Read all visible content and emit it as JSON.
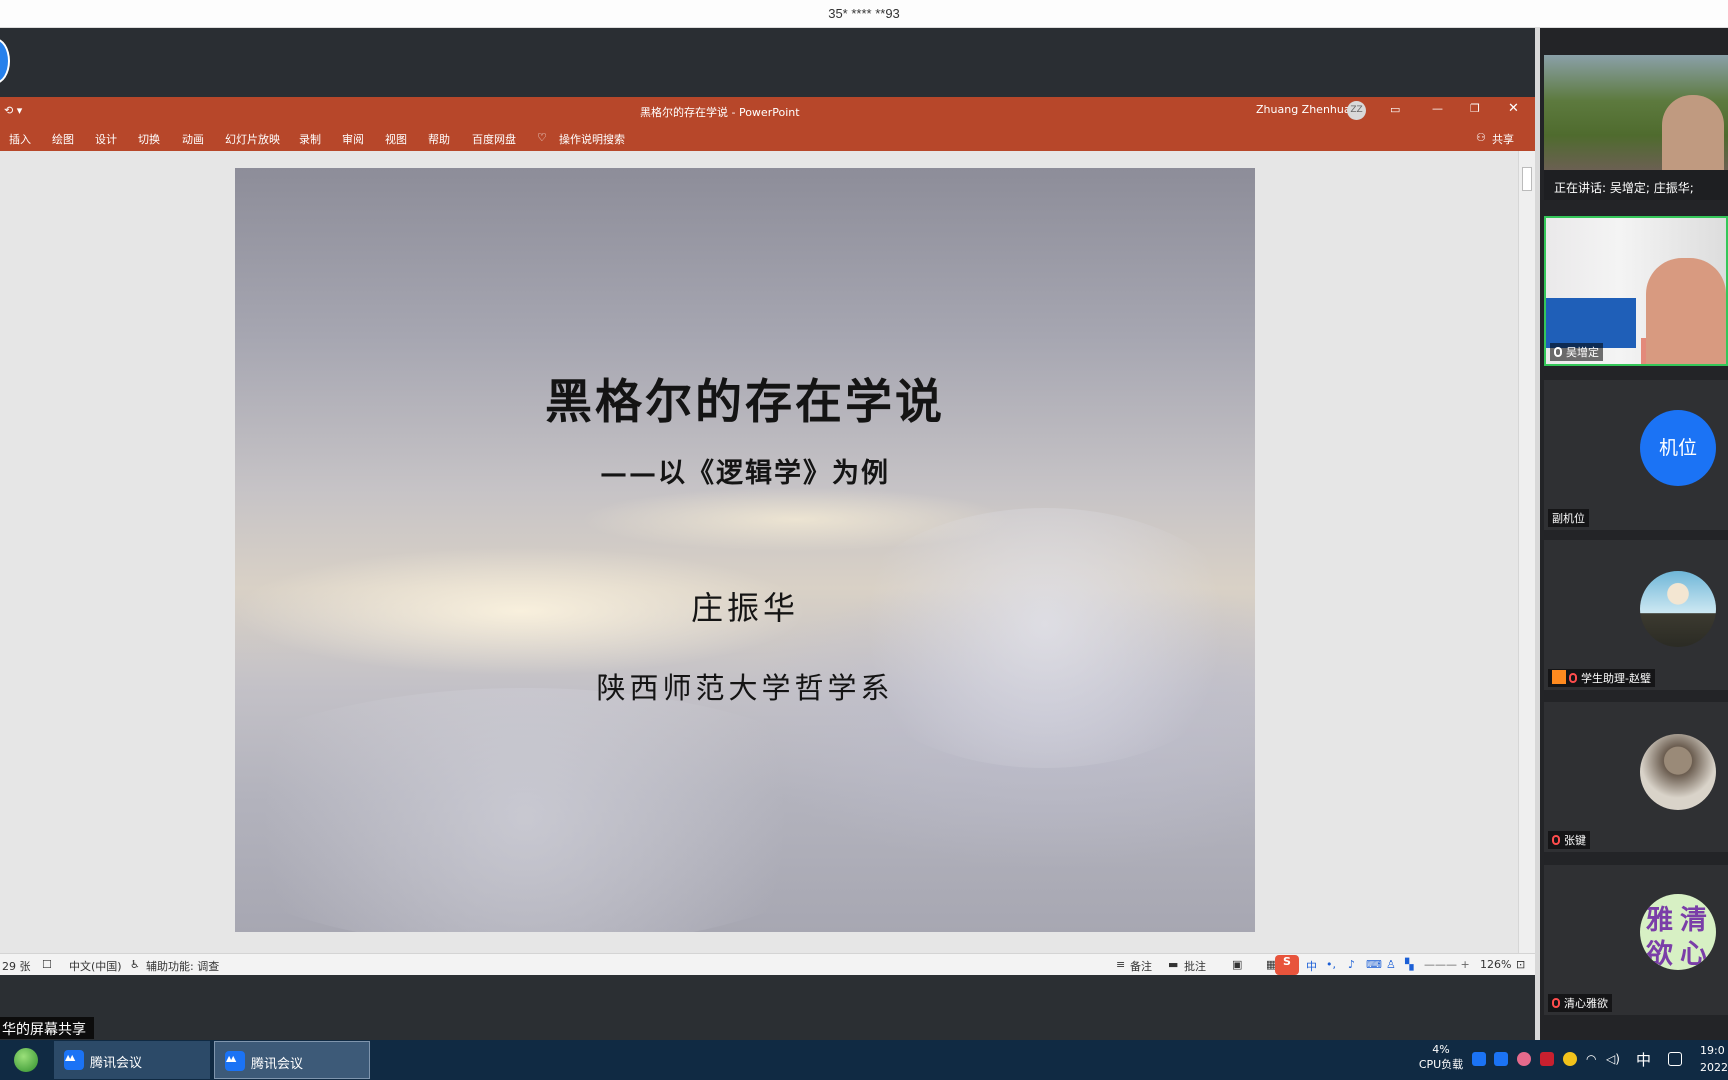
{
  "meeting": {
    "caller": "35* **** **93"
  },
  "ppt": {
    "title": "黑格尔的存在学说  -  PowerPoint",
    "user": "Zhuang Zhenhua",
    "user_initials": "ZZ",
    "quick_access": "⟲  ▾",
    "ribbon": [
      "插入",
      "绘图",
      "设计",
      "切换",
      "动画",
      "幻灯片放映",
      "录制",
      "审阅",
      "视图",
      "帮助",
      "百度网盘"
    ],
    "tell_me": "操作说明搜索",
    "share": "共享",
    "status": {
      "slides": "29 张",
      "language": "中文(中国)",
      "accessibility": "辅助功能: 调查",
      "notes": "备注",
      "comments": "批注",
      "zoom": "126%"
    }
  },
  "slide": {
    "title": "黑格尔的存在学说",
    "subtitle": "——以《逻辑学》为例",
    "author": "庄振华",
    "affiliation": "陕西师范大学哲学系"
  },
  "panel": {
    "speaking": "正在讲话: 吴增定; 庄振华;",
    "participants": [
      {
        "name": "吴增定"
      },
      {
        "name": "副机位",
        "avatar_text": "机位"
      },
      {
        "name": "学生助理-赵璧"
      },
      {
        "name": "张键"
      },
      {
        "name": "清心雅欲",
        "avatar_chars": [
          "雅",
          "清",
          "欲",
          "心"
        ]
      }
    ]
  },
  "share_label": "华的屏幕共享",
  "taskbar": {
    "apps": [
      "腾讯会议",
      "腾讯会议"
    ],
    "cpu_percent": "4%",
    "cpu_label": "CPU负载",
    "ime": "中",
    "clock_time": "19:0",
    "clock_date": "2022"
  },
  "colors": {
    "ppt_accent": "#b7472a",
    "meeting_blue": "#1b73f5",
    "speaking_border": "#34c759"
  }
}
